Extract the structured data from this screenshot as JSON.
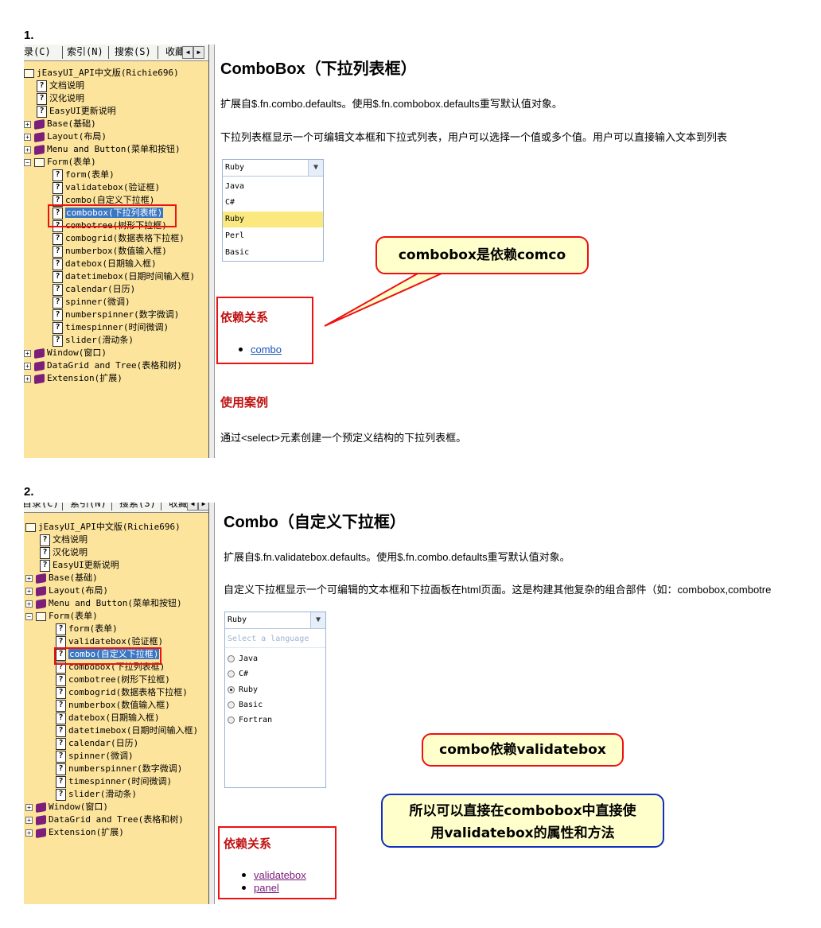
{
  "steps": [
    "1.",
    "2."
  ],
  "tabs1": [
    "录(C)",
    "索引(N)",
    "搜索(S)",
    "收藏"
  ],
  "tabs2": [
    "目录(C)",
    "索引(N)",
    "搜索(S)",
    "收藏"
  ],
  "tree": {
    "root": "jEasyUI_API中文版(Richie696)",
    "docs": [
      "文档说明",
      "汉化说明",
      "EasyUI更新说明"
    ],
    "groups_top": [
      "Base(基础)",
      "Layout(布局)",
      "Menu and Button(菜单和按钮)"
    ],
    "form": "Form(表单)",
    "form_children": [
      "form(表单)",
      "validatebox(验证框)",
      "combo(自定义下拉框)",
      "combobox(下拉列表框)",
      "combotree(树形下拉框)",
      "combogrid(数据表格下拉框)",
      "numberbox(数值输入框)",
      "datebox(日期输入框)",
      "datetimebox(日期时间输入框)",
      "calendar(日历)",
      "spinner(微调)",
      "numberspinner(数字微调)",
      "timespinner(时间微调)",
      "slider(滑动条)"
    ],
    "groups_bottom": [
      "Window(窗口)",
      "DataGrid and Tree(表格和树)",
      "Extension(扩展)"
    ]
  },
  "panel1": {
    "title": "ComboBox（下拉列表框）",
    "extends": "扩展自$.fn.combo.defaults。使用$.fn.combobox.defaults重写默认值对象。",
    "desc": "下拉列表框显示一个可编辑文本框和下拉式列表，用户可以选择一个值或多个值。用户可以直接输入文本到列表",
    "combo_value": "Ruby",
    "options": [
      "Java",
      "C#",
      "Ruby",
      "Perl",
      "Basic"
    ],
    "highlighted": "Ruby",
    "deps_heading": "依赖关系",
    "deps": [
      "combo"
    ],
    "usage_heading": "使用案例",
    "usage_text": "通过<select>元素创建一个预定义结构的下拉列表框。",
    "callout": "combobox是依赖comco"
  },
  "panel2": {
    "title": "Combo（自定义下拉框）",
    "extends": "扩展自$.fn.validatebox.defaults。使用$.fn.combo.defaults重写默认值对象。",
    "desc": "自定义下拉框显示一个可编辑的文本框和下拉面板在html页面。这是构建其他复杂的组合部件（如：combobox,combotre",
    "combo_value": "Ruby",
    "panel_header": "Select a language",
    "options": [
      "Java",
      "C#",
      "Ruby",
      "Basic",
      "Fortran"
    ],
    "selected": "Ruby",
    "deps_heading": "依赖关系",
    "deps": [
      "validatebox",
      "panel"
    ],
    "callout1": "combo依赖validatebox",
    "callout2_line1": "所以可以直接在combobox中直接使",
    "callout2_line2": "用validatebox的属性和方法"
  },
  "colors": {
    "tree_bg": "#fde49c",
    "highlight": "#e11111",
    "callout_bg": "#ffffcc",
    "callout2_border": "#1030c0"
  }
}
